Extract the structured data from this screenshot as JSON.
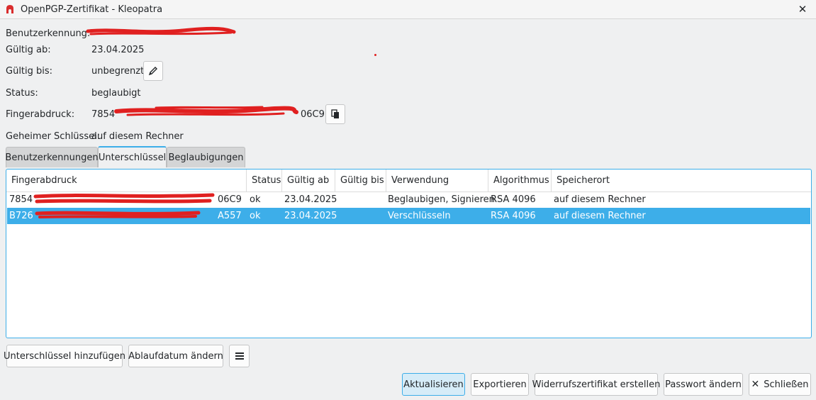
{
  "window": {
    "title": "OpenPGP-Zertifikat - Kleopatra",
    "icons": {
      "app": "kleopatra-app-icon",
      "close": "close-icon"
    }
  },
  "info": {
    "user_id_label": "Benutzerkennung:",
    "valid_from_label": "Gültig ab:",
    "valid_from_value": "23.04.2025",
    "valid_until_label": "Gültig bis:",
    "valid_until_value": "unbegrenzt",
    "status_label": "Status:",
    "status_value": "beglaubigt",
    "fingerprint_label": "Fingerabdruck:",
    "fingerprint_prefix": "7854",
    "fingerprint_suffix": "06C9",
    "secret_key_label": "Geheimer Schlüssel:",
    "secret_key_value": "auf diesem Rechner"
  },
  "tabs": [
    {
      "label": "Benutzerkennungen",
      "active": false
    },
    {
      "label": "Unterschlüssel",
      "active": true
    },
    {
      "label": "Beglaubigungen",
      "active": false
    }
  ],
  "table": {
    "columns": [
      "Fingerabdruck",
      "Status",
      "Gültig ab",
      "Gültig bis",
      "Verwendung",
      "Algorithmus",
      "Speicherort"
    ],
    "rows": [
      {
        "fingerprint_prefix": "7854",
        "fingerprint_suffix": "06C9",
        "status": "ok",
        "valid_from": "23.04.2025",
        "valid_until": "",
        "usage": "Beglaubigen, Signieren",
        "algorithm": "RSA 4096",
        "location": "auf diesem Rechner",
        "selected": false
      },
      {
        "fingerprint_prefix": "B726",
        "fingerprint_suffix": "A557",
        "status": "ok",
        "valid_from": "23.04.2025",
        "valid_until": "",
        "usage": "Verschlüsseln",
        "algorithm": "RSA 4096",
        "location": "auf diesem Rechner",
        "selected": true
      }
    ]
  },
  "actions": {
    "add_subkey": "Unterschlüssel hinzufügen",
    "change_expiry": "Ablaufdatum ändern",
    "menu_icon": "hamburger-menu-icon"
  },
  "footer": {
    "refresh": "Aktualisieren",
    "export": "Exportieren",
    "revocation": "Widerrufszertifikat erstellen",
    "change_password": "Passwort ändern",
    "close": "Schließen"
  },
  "colors": {
    "accent": "#3daee9",
    "selection_text": "#ffffff",
    "redaction": "#e02020",
    "window_bg": "#eff0f1"
  }
}
